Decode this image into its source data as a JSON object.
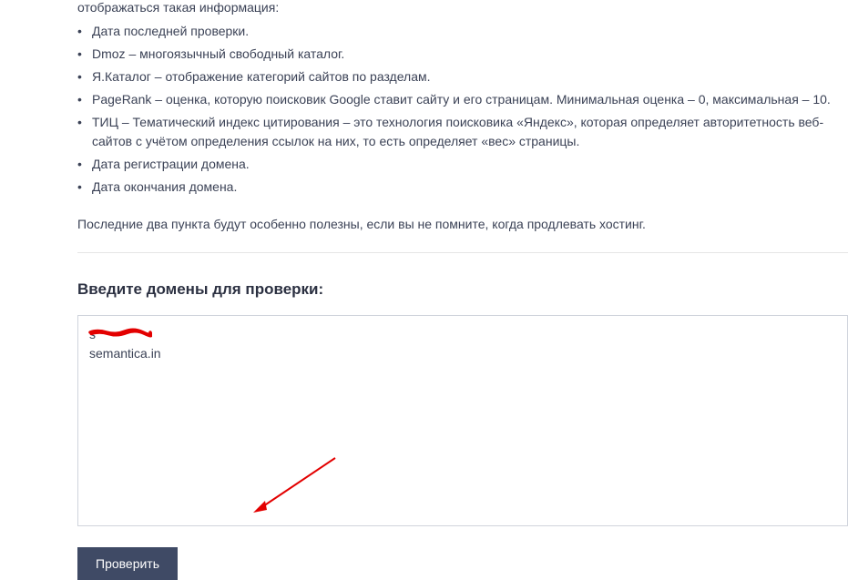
{
  "partial_text": "отображаться такая информация:",
  "list_items": [
    "Дата последней проверки.",
    "Dmoz – многоязычный свободный каталог.",
    "Я.Каталог – отображение категорий сайтов по разделам.",
    "PageRank – оценка, которую поисковик Google ставит сайту и его страницам. Минимальная оценка – 0, максимальная – 10.",
    "ТИЦ – Тематический индекс цитирования – это технология поисковика «Яндекс», которая определяет авторитетность веб-сайтов с учётом определения ссылок на них, то есть определяет «вес» страницы.",
    "Дата регистрации домена.",
    "Дата окончания домена."
  ],
  "note": "Последние два пункта будут особенно полезны, если вы не помните, когда продлевать хостинг.",
  "section_title": "Введите домены для проверки:",
  "textarea_value": "s           \nsemantica.in",
  "button_label": "Проверить"
}
